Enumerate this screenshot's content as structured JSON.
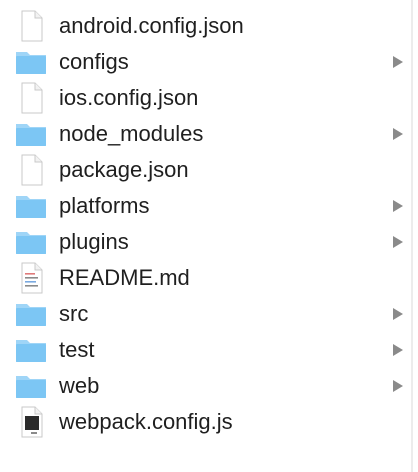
{
  "items": [
    {
      "name": "android.config.json",
      "type": "file",
      "icon": "json-file-icon",
      "expandable": false
    },
    {
      "name": "configs",
      "type": "folder",
      "icon": "folder-icon",
      "expandable": true
    },
    {
      "name": "ios.config.json",
      "type": "file",
      "icon": "json-file-icon",
      "expandable": false
    },
    {
      "name": "node_modules",
      "type": "folder",
      "icon": "folder-icon",
      "expandable": true
    },
    {
      "name": "package.json",
      "type": "file",
      "icon": "json-file-icon",
      "expandable": false
    },
    {
      "name": "platforms",
      "type": "folder",
      "icon": "folder-icon",
      "expandable": true
    },
    {
      "name": "plugins",
      "type": "folder",
      "icon": "folder-icon",
      "expandable": true
    },
    {
      "name": "README.md",
      "type": "markdown",
      "icon": "markdown-file-icon",
      "expandable": false
    },
    {
      "name": "src",
      "type": "folder",
      "icon": "folder-icon",
      "expandable": true
    },
    {
      "name": "test",
      "type": "folder",
      "icon": "folder-icon",
      "expandable": true
    },
    {
      "name": "web",
      "type": "folder",
      "icon": "folder-icon",
      "expandable": true
    },
    {
      "name": "webpack.config.js",
      "type": "js",
      "icon": "js-file-icon",
      "expandable": false
    }
  ],
  "colors": {
    "folder": "#7cc6f4",
    "folder_tab": "#9fd5f7",
    "text": "#1f1f1f",
    "arrow": "#8a8a8a"
  }
}
